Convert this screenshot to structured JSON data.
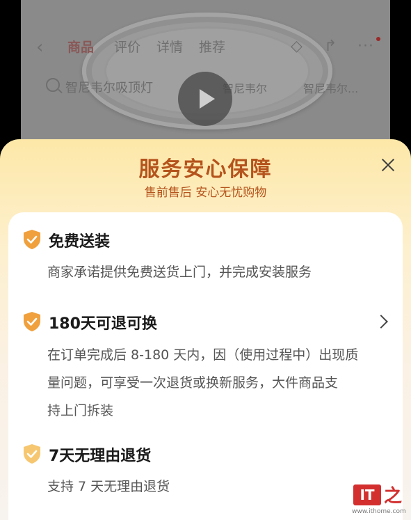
{
  "background_page": {
    "tabs": [
      {
        "label": "商品",
        "active": true
      },
      {
        "label": "评价",
        "active": false
      },
      {
        "label": "详情",
        "active": false
      },
      {
        "label": "推荐",
        "active": false
      }
    ],
    "search": {
      "query": "智尼韦尔吸顶灯",
      "chips": [
        "智尼韦尔",
        "智尼韦尔..."
      ]
    },
    "icons": [
      "back-icon",
      "cart-icon",
      "share-icon",
      "more-icon",
      "play-icon",
      "search-icon"
    ]
  },
  "sheet": {
    "title": "服务安心保障",
    "subtitle": "售前售后 安心无忧购物",
    "close_icon": "close-icon",
    "accent_color": "#b5531c",
    "shield_color": "#f0a03c"
  },
  "services": [
    {
      "title": "免费送装",
      "description": "商家承诺提供免费送货上门，并完成安装服务",
      "has_arrow": false
    },
    {
      "title": "180天可退可换",
      "description_lines": [
        "在订单完成后 8-180 天内，因（使用过程中）出现质",
        "量问题，可享受一次退货或换新服务，大件商品支",
        "持上门拆装"
      ],
      "has_arrow": true
    },
    {
      "title": "7天无理由退货",
      "description": "支持 7 天无理由退货",
      "has_arrow": false
    }
  ],
  "watermark": {
    "logo_text": "IT",
    "logo_char": "之家",
    "url": "www.ithome.com"
  }
}
